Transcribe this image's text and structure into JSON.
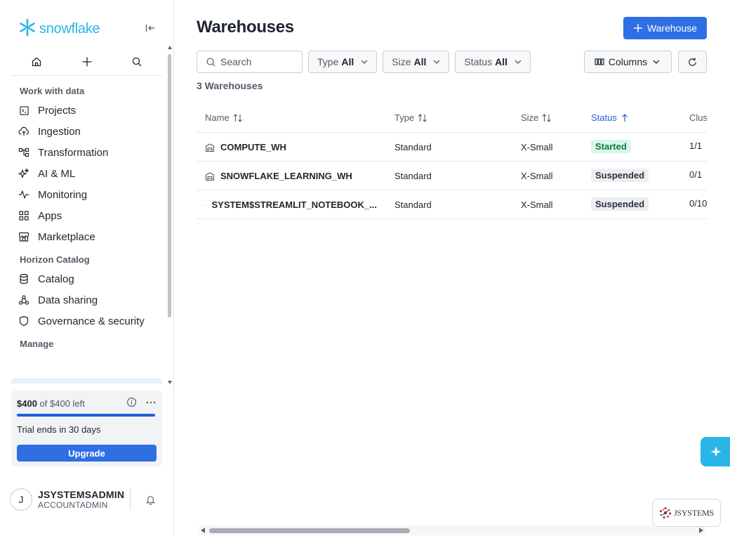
{
  "brand": {
    "name": "snowflake",
    "color": "#29b5e8"
  },
  "sidebar": {
    "sections": [
      {
        "title": "Work with data",
        "items": [
          {
            "label": "Projects",
            "icon": "terminal-icon"
          },
          {
            "label": "Ingestion",
            "icon": "cloud-upload-icon"
          },
          {
            "label": "Transformation",
            "icon": "flow-icon"
          },
          {
            "label": "AI & ML",
            "icon": "sparkle-icon"
          },
          {
            "label": "Monitoring",
            "icon": "pulse-icon"
          },
          {
            "label": "Apps",
            "icon": "grid-icon"
          },
          {
            "label": "Marketplace",
            "icon": "store-icon"
          }
        ]
      },
      {
        "title": "Horizon Catalog",
        "items": [
          {
            "label": "Catalog",
            "icon": "database-icon"
          },
          {
            "label": "Data sharing",
            "icon": "share-icon"
          },
          {
            "label": "Governance & security",
            "icon": "shield-icon"
          }
        ]
      },
      {
        "title": "Manage",
        "items": []
      }
    ]
  },
  "trial": {
    "amount": "$400",
    "of_text": "of $400 left",
    "remaining_fraction": 1.0,
    "ends_text": "Trial ends in 30 days",
    "upgrade_label": "Upgrade"
  },
  "user": {
    "initial": "J",
    "name": "JSYSTEMSADMIN",
    "role": "ACCOUNTADMIN"
  },
  "main": {
    "title": "Warehouses",
    "add_label": "Warehouse",
    "search_placeholder": "Search",
    "filters": [
      {
        "label": "Type",
        "value": "All"
      },
      {
        "label": "Size",
        "value": "All"
      },
      {
        "label": "Status",
        "value": "All"
      }
    ],
    "columns_label": "Columns",
    "count_text": "3 Warehouses",
    "headers": {
      "name": "Name",
      "type": "Type",
      "size": "Size",
      "status": "Status",
      "clusters": "Clus"
    },
    "rows": [
      {
        "name": "COMPUTE_WH",
        "type": "Standard",
        "size": "X-Small",
        "status": "Started",
        "clusters": "1/1"
      },
      {
        "name": "SNOWFLAKE_LEARNING_WH",
        "type": "Standard",
        "size": "X-Small",
        "status": "Suspended",
        "clusters": "0/1"
      },
      {
        "name": "SYSTEM$STREAMLIT_NOTEBOOK_...",
        "type": "Standard",
        "size": "X-Small",
        "status": "Suspended",
        "clusters": "0/10"
      }
    ]
  },
  "corner_logo": "JSYSTEMS",
  "colors": {
    "primary": "#2f6fe4",
    "started_bg": "#d8f7e6",
    "started_fg": "#147a3e",
    "suspended_bg": "#eceef1"
  }
}
